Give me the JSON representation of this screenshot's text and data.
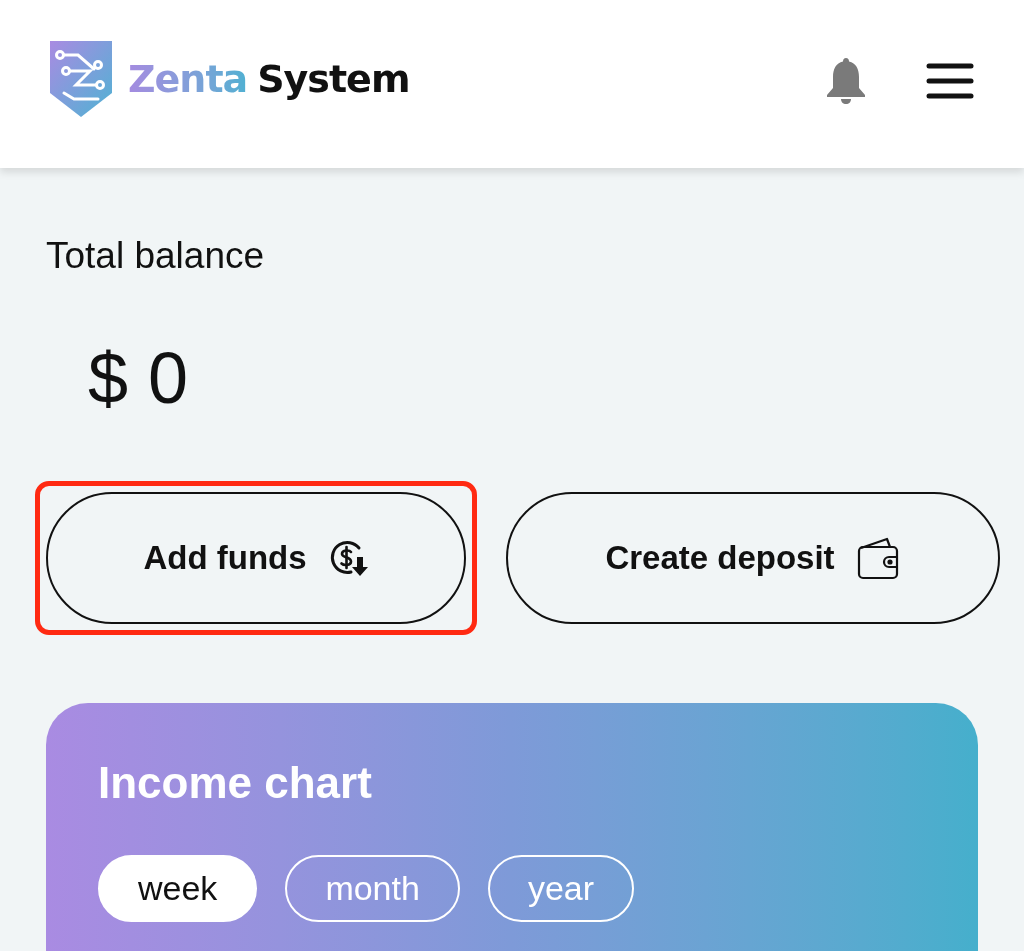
{
  "header": {
    "brand": {
      "first": "Zenta",
      "second": "System"
    }
  },
  "balance": {
    "label": "Total balance",
    "amount": "$ 0"
  },
  "actions": [
    {
      "kind": "add-funds",
      "label": "Add funds",
      "highlighted": true
    },
    {
      "kind": "create-deposit",
      "label": "Create deposit",
      "highlighted": false
    }
  ],
  "income_chart": {
    "title": "Income chart",
    "periods": [
      {
        "label": "week",
        "selected": true
      },
      {
        "label": "month",
        "selected": false
      },
      {
        "label": "year",
        "selected": false
      }
    ]
  }
}
